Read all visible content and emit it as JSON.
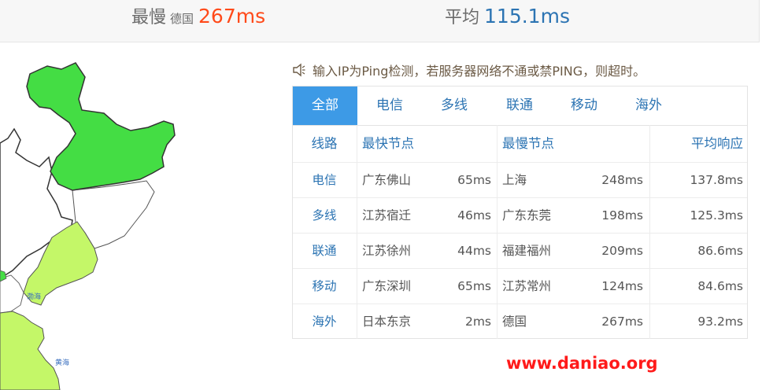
{
  "summary": {
    "slowest_label": "最慢",
    "slowest_location": "德国",
    "slowest_value": "267ms",
    "average_label": "平均",
    "average_value": "115.1ms"
  },
  "notice": {
    "icon": "speaker-icon",
    "text": "输入IP为Ping检测，若服务器网络不通或禁PING，则超时。"
  },
  "tabs": [
    {
      "label": "全部",
      "active": true
    },
    {
      "label": "电信",
      "active": false
    },
    {
      "label": "多线",
      "active": false
    },
    {
      "label": "联通",
      "active": false
    },
    {
      "label": "移动",
      "active": false
    },
    {
      "label": "海外",
      "active": false
    }
  ],
  "table": {
    "headers": {
      "isp": "线路",
      "fastest": "最快节点",
      "slowest": "最慢节点",
      "average": "平均响应"
    },
    "rows": [
      {
        "isp": "电信",
        "fastest_node": "广东佛山",
        "fastest_ms": "65ms",
        "slowest_node": "上海",
        "slowest_ms": "248ms",
        "average": "137.8ms"
      },
      {
        "isp": "多线",
        "fastest_node": "江苏宿迁",
        "fastest_ms": "46ms",
        "slowest_node": "广东东莞",
        "slowest_ms": "198ms",
        "average": "125.3ms"
      },
      {
        "isp": "联通",
        "fastest_node": "江苏徐州",
        "fastest_ms": "44ms",
        "slowest_node": "福建福州",
        "slowest_ms": "209ms",
        "average": "86.6ms"
      },
      {
        "isp": "移动",
        "fastest_node": "广东深圳",
        "fastest_ms": "65ms",
        "slowest_node": "江苏常州",
        "slowest_ms": "124ms",
        "average": "84.6ms"
      },
      {
        "isp": "海外",
        "fastest_node": "日本东京",
        "fastest_ms": "2ms",
        "slowest_node": "德国",
        "slowest_ms": "267ms",
        "average": "93.2ms"
      }
    ]
  },
  "map": {
    "colors": {
      "fast": "#44dd44",
      "medium": "#c4f768",
      "border": "#333333",
      "sea_label": "#3a6fbf"
    },
    "sea_labels": [
      "渤海",
      "黄海"
    ]
  },
  "watermark": "www.daniao.org",
  "colors": {
    "accent": "#3d9ae6",
    "link": "#2c74b3",
    "slow": "#ff4a1a",
    "watermark": "#ff1a1a"
  }
}
